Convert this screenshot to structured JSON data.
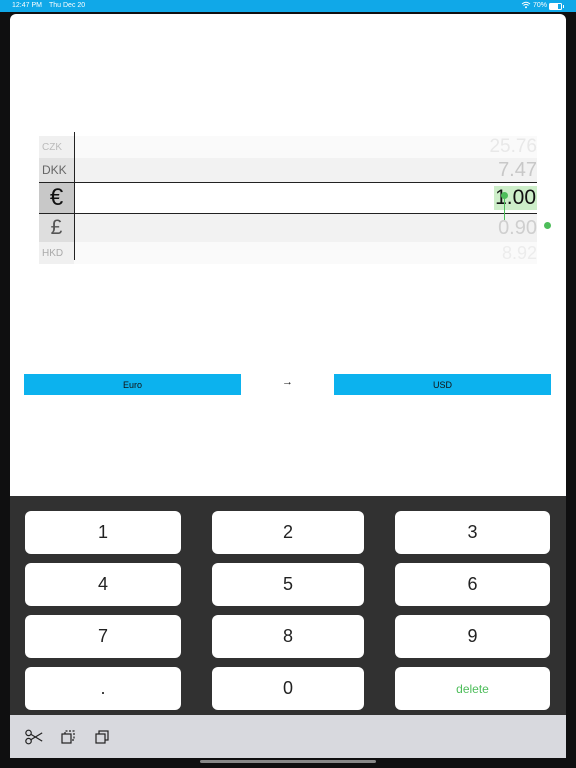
{
  "status_bar": {
    "time": "12:47 PM",
    "date": "Thu Dec 20",
    "battery": "70%",
    "battery_level": 0.7
  },
  "picker": {
    "rows": [
      {
        "code": "CZK",
        "value": "25.76"
      },
      {
        "code": "DKK",
        "value": "7.47"
      },
      {
        "code": "€",
        "value": "1.00"
      },
      {
        "code": "£",
        "value": "0.90"
      },
      {
        "code": "HKD",
        "value": "8.92"
      }
    ]
  },
  "conversion": {
    "from_label": "Euro",
    "arrow": "→",
    "to_label": "USD"
  },
  "keypad": {
    "keys": [
      "1",
      "2",
      "3",
      "4",
      "5",
      "6",
      "7",
      "8",
      "9",
      ".",
      "0",
      "delete"
    ]
  },
  "toolbar": {
    "items": [
      "scissors-icon",
      "copy-icon",
      "paste-icon"
    ]
  },
  "colors": {
    "accent": "#0cb2ee",
    "status_bar": "#10a8e8",
    "selection": "#cdeec9",
    "handle": "#4dbd5a",
    "keypad_bg": "#313131"
  }
}
